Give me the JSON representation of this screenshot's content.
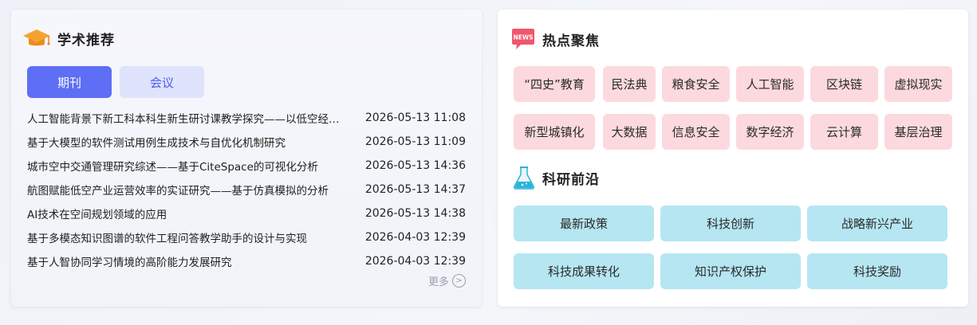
{
  "academic": {
    "title": "学术推荐",
    "tabs": [
      "期刊",
      "会议"
    ],
    "items": [
      {
        "title": "人工智能背景下新工科本科生新生研讨课教学探究——以低空经济为例",
        "date": "2026-05-13 11:08"
      },
      {
        "title": "基于大模型的软件测试用例生成技术与自优化机制研究",
        "date": "2026-05-13 11:09"
      },
      {
        "title": "城市空中交通管理研究综述——基于CiteSpace的可视化分析",
        "date": "2026-05-13 14:36"
      },
      {
        "title": "航图赋能低空产业运营效率的实证研究——基于仿真模拟的分析",
        "date": "2026-05-13 14:37"
      },
      {
        "title": "AI技术在空间规划领域的应用",
        "date": "2026-05-13 14:38"
      },
      {
        "title": "基于多模态知识图谱的软件工程问答教学助手的设计与实现",
        "date": "2026-04-03 12:39"
      },
      {
        "title": "基于人智协同学习情境的高阶能力发展研究",
        "date": "2026-04-03 12:39"
      }
    ],
    "more": "更多"
  },
  "hot": {
    "title": "热点聚焦",
    "icon_text": "NEWS",
    "tags": [
      "“四史”教育",
      "民法典",
      "粮食安全",
      "人工智能",
      "区块链",
      "虚拟现实",
      "新型城镇化",
      "大数据",
      "信息安全",
      "数字经济",
      "云计算",
      "基层治理"
    ]
  },
  "frontier": {
    "title": "科研前沿",
    "items": [
      "最新政策",
      "科技创新",
      "战略新兴产业",
      "科技成果转化",
      "知识产权保护",
      "科技奖励"
    ]
  },
  "colors": {
    "primary": "#5e6ef5",
    "tab_inactive_bg": "#dfe3fb",
    "hot_tag_bg": "#fcd9de",
    "frontier_bg": "#b5e6f2",
    "news_icon": "#f0566e"
  }
}
